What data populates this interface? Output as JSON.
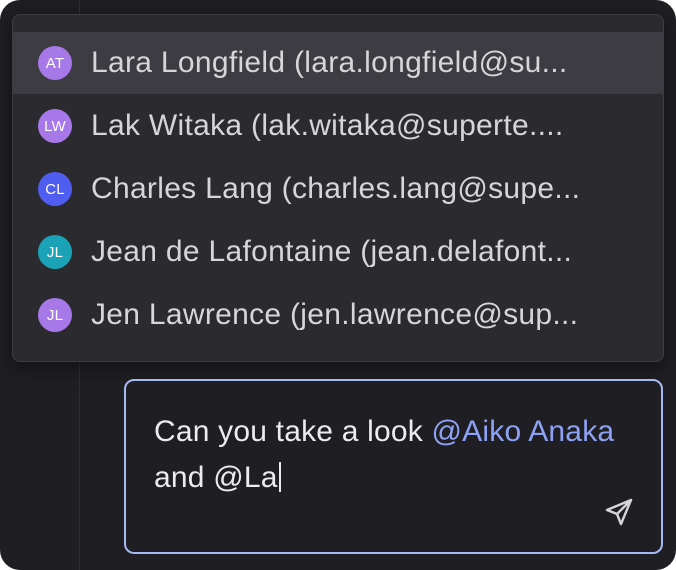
{
  "mention_dropdown": {
    "items": [
      {
        "initials": "AT",
        "label": "Lara Longfield (lara.longfield@su...",
        "avatar_color": "#a778e8",
        "active": true
      },
      {
        "initials": "LW",
        "label": "Lak Witaka (lak.witaka@superte....",
        "avatar_color": "#a778e8",
        "active": false
      },
      {
        "initials": "CL",
        "label": "Charles Lang (charles.lang@supe...",
        "avatar_color": "#4f5df0",
        "active": false
      },
      {
        "initials": "JL",
        "label": "Jean de Lafontaine (jean.delafont...",
        "avatar_color": "#1aa3b6",
        "active": false
      },
      {
        "initials": "JL",
        "label": "Jen Lawrence (jen.lawrence@sup...",
        "avatar_color": "#a778e8",
        "active": false
      }
    ]
  },
  "composer": {
    "text_before": "Can you take a look ",
    "mention": "@Aiko Anaka",
    "text_after": " and @La",
    "send_icon": "send-icon",
    "border_color": "#a7b9f3",
    "mention_color": "#8ea2f5"
  }
}
